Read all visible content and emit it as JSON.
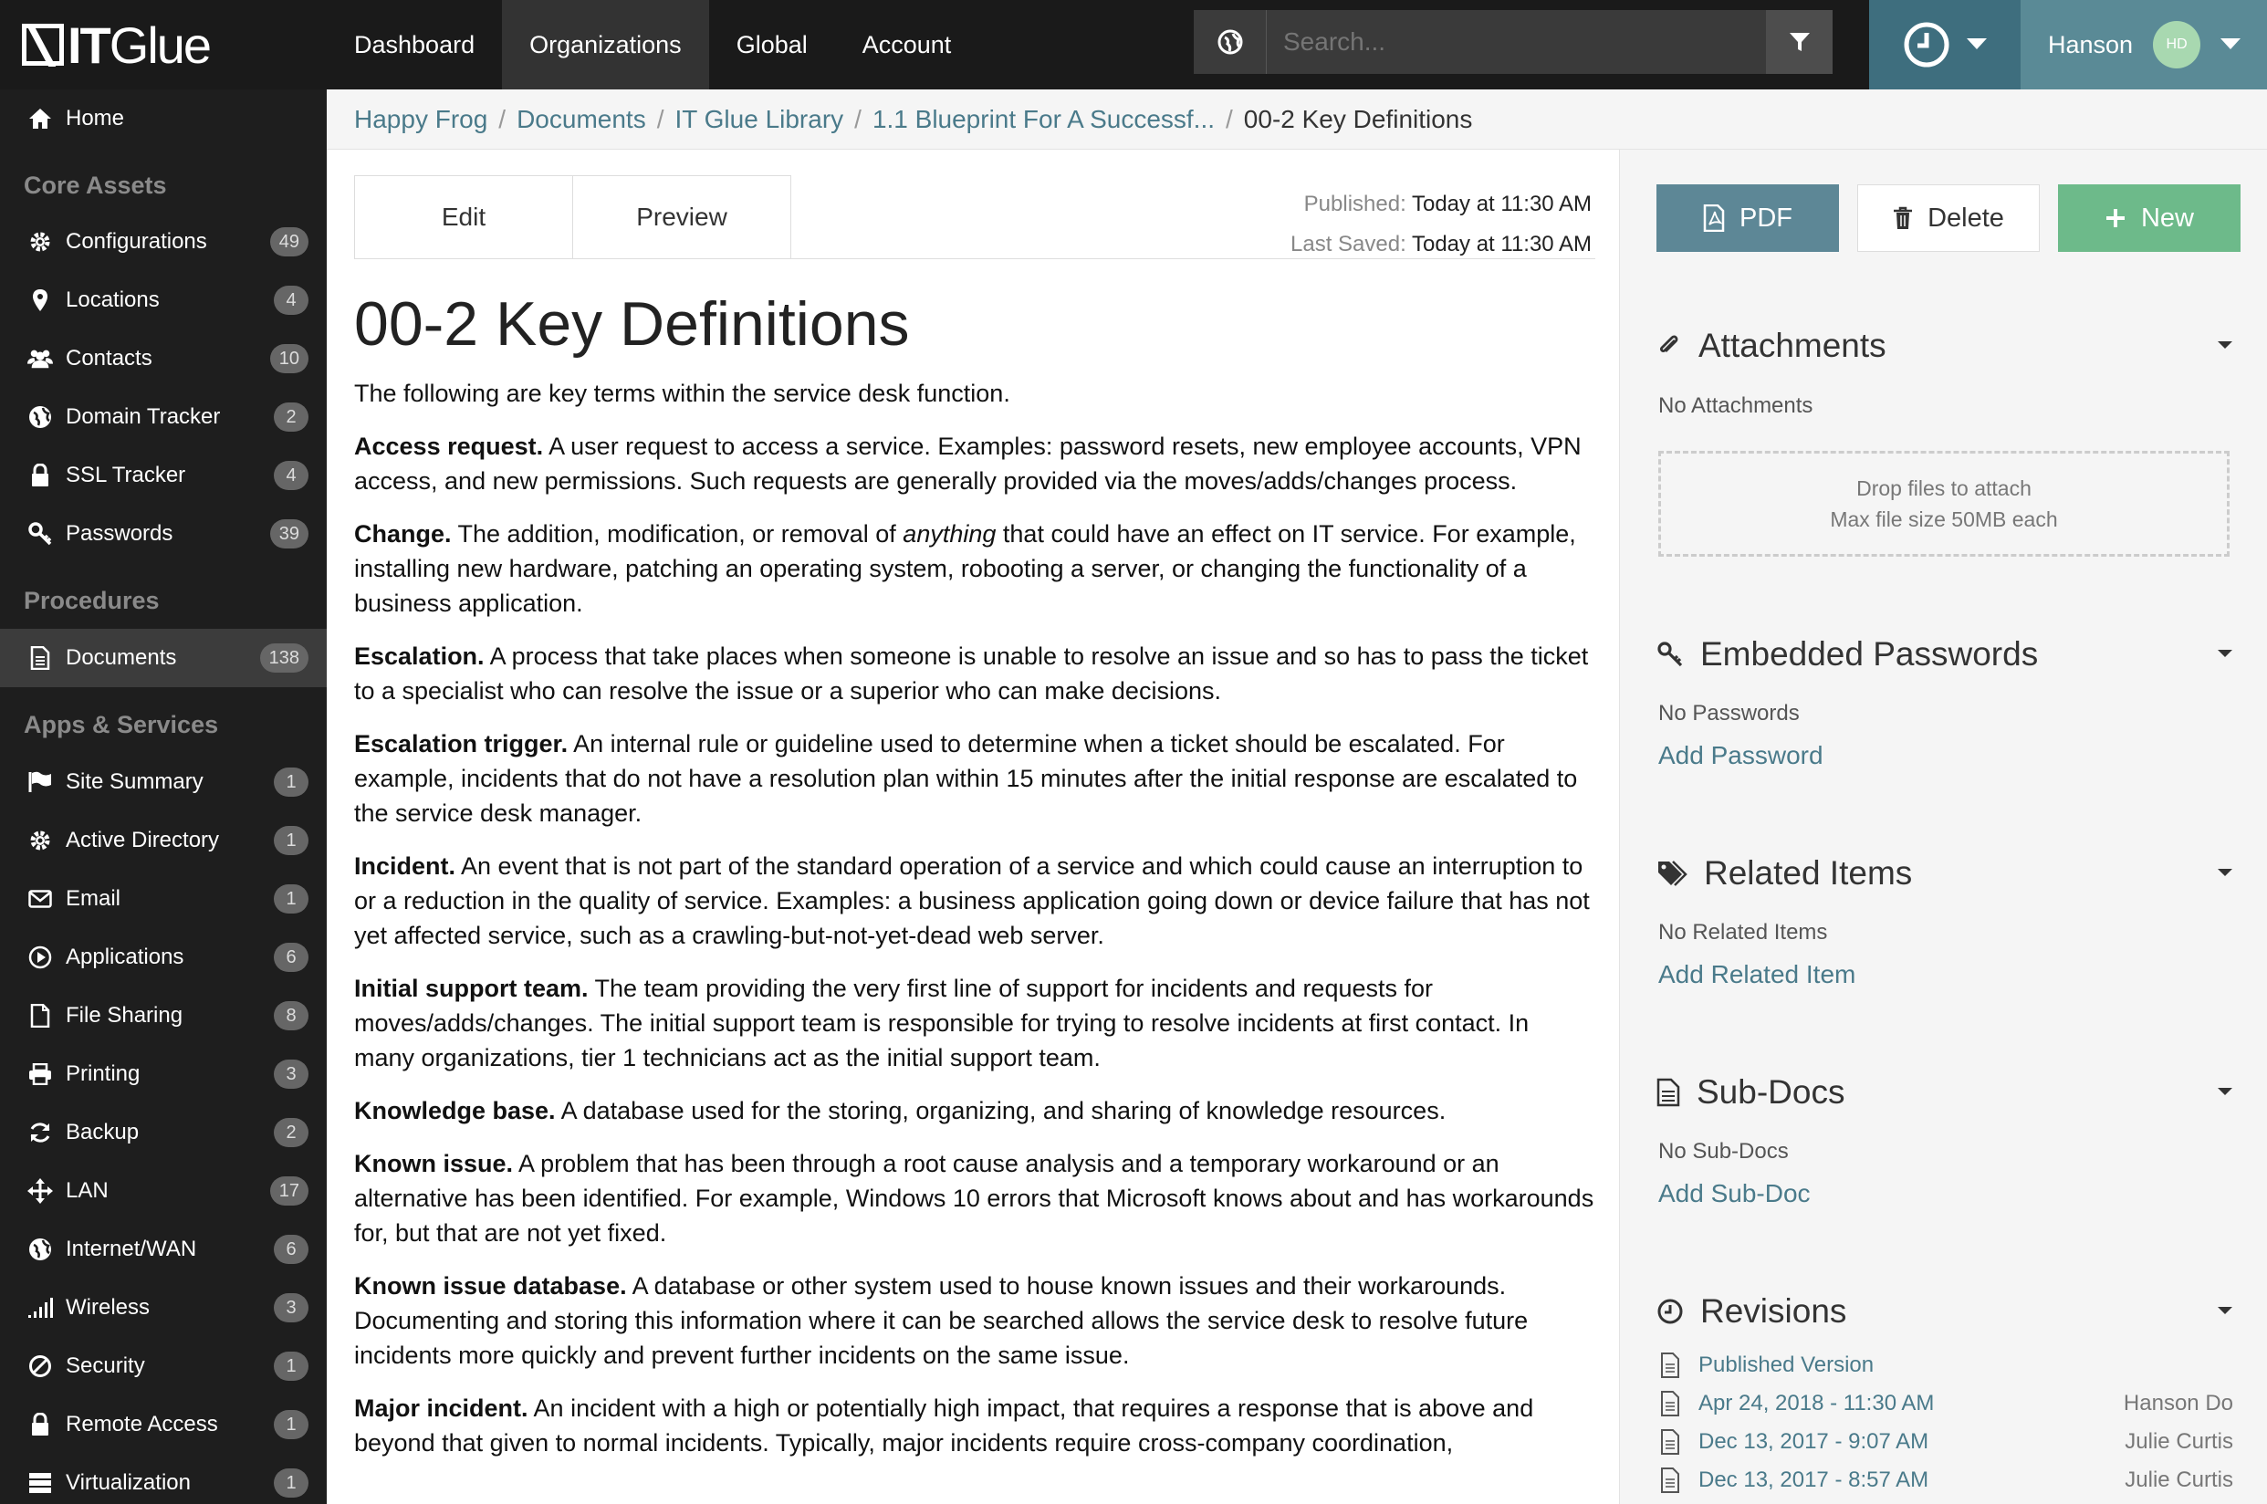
{
  "app": {
    "logo_it": "IT",
    "logo_glue": "Glue"
  },
  "topnav": {
    "tabs": [
      "Dashboard",
      "Organizations",
      "Global",
      "Account"
    ],
    "active": "Organizations"
  },
  "search": {
    "placeholder": "Search..."
  },
  "user": {
    "name": "Hanson",
    "initials": "HD"
  },
  "sidebar": {
    "home": "Home",
    "core_assets": "Core Assets",
    "core_items": [
      {
        "label": "Configurations",
        "count": "49",
        "icon": "gear-icon"
      },
      {
        "label": "Locations",
        "count": "4",
        "icon": "map-pin-icon"
      },
      {
        "label": "Contacts",
        "count": "10",
        "icon": "users-icon"
      },
      {
        "label": "Domain Tracker",
        "count": "2",
        "icon": "globe-icon"
      },
      {
        "label": "SSL Tracker",
        "count": "4",
        "icon": "lock-icon"
      },
      {
        "label": "Passwords",
        "count": "39",
        "icon": "key-icon"
      }
    ],
    "procedures": "Procedures",
    "procedure_items": [
      {
        "label": "Documents",
        "count": "138",
        "icon": "document-icon"
      }
    ],
    "apps_services": "Apps & Services",
    "app_items": [
      {
        "label": "Site Summary",
        "count": "1",
        "icon": "flag-icon"
      },
      {
        "label": "Active Directory",
        "count": "1",
        "icon": "gear-icon"
      },
      {
        "label": "Email",
        "count": "1",
        "icon": "envelope-icon"
      },
      {
        "label": "Applications",
        "count": "6",
        "icon": "play-circle-icon"
      },
      {
        "label": "File Sharing",
        "count": "8",
        "icon": "file-icon"
      },
      {
        "label": "Printing",
        "count": "3",
        "icon": "printer-icon"
      },
      {
        "label": "Backup",
        "count": "2",
        "icon": "refresh-icon"
      },
      {
        "label": "LAN",
        "count": "17",
        "icon": "arrows-icon"
      },
      {
        "label": "Internet/WAN",
        "count": "6",
        "icon": "globe-icon"
      },
      {
        "label": "Wireless",
        "count": "3",
        "icon": "signal-icon"
      },
      {
        "label": "Security",
        "count": "1",
        "icon": "ban-icon"
      },
      {
        "label": "Remote Access",
        "count": "1",
        "icon": "lock-icon"
      },
      {
        "label": "Virtualization",
        "count": "1",
        "icon": "server-icon"
      }
    ]
  },
  "breadcrumb": {
    "items": [
      "Happy Frog",
      "Documents",
      "IT Glue Library",
      "1.1 Blueprint For A Successf..."
    ],
    "current": "00-2 Key Definitions"
  },
  "editor": {
    "edit_tab": "Edit",
    "preview_tab": "Preview",
    "published_label": "Published:",
    "published_value": "Today at 11:30 AM",
    "saved_label": "Last Saved:",
    "saved_value": "Today at 11:30 AM"
  },
  "document": {
    "title": "00-2 Key Definitions",
    "intro": "The following are key terms within the service desk function.",
    "terms": [
      {
        "term": "Access request.",
        "def": "A user request to access a service. Examples: password resets, new employee accounts, VPN access, and new permissions. Such requests are generally provided via the moves/adds/changes process."
      },
      {
        "term": "Change.",
        "def_before": "The addition, modification, or removal of",
        "def_em": "anything",
        "def_after": "that could have an effect on IT service. For example, installing new hardware, patching an operating system, robooting a server, or changing the functionality of a business application."
      },
      {
        "term": "Escalation.",
        "def": "A process that take places when someone is unable to resolve an issue and so has to pass the ticket to a specialist who can resolve the issue or a superior who can make decisions."
      },
      {
        "term": "Escalation trigger.",
        "def": "An internal rule or guideline used to determine when a ticket should be escalated. For example, incidents that do not have a resolution plan within 15 minutes after the initial response are escalated to the service desk manager."
      },
      {
        "term": "Incident.",
        "def": "An event that is not part of the standard operation of a service and which could cause an interruption to or a reduction in the quality of service. Examples: a business application going down or device failure that has not yet affected service, such as a crawling-but-not-yet-dead web server."
      },
      {
        "term": "Initial support team.",
        "def": "The team providing the very first line of support for incidents and requests for moves/adds/changes. The initial support team is responsible for trying to resolve incidents at first contact. In many organizations, tier 1 technicians act as the initial support team."
      },
      {
        "term": "Knowledge base.",
        "def": "A database used for the storing, organizing, and sharing of knowledge resources."
      },
      {
        "term": "Known issue.",
        "def": "A problem that has been through a root cause analysis and a temporary workaround or an alternative has been identified. For example, Windows 10 errors that Microsoft knows about and has workarounds for, but that are not yet fixed."
      },
      {
        "term": "Known issue database.",
        "def": "A database or other system used to house known issues and their workarounds. Documenting and storing this information where it can be searched allows the service desk to resolve future incidents more quickly and prevent further incidents on the same issue."
      },
      {
        "term": "Major incident.",
        "def": "An incident with a high or potentially high impact, that requires a response that is above and beyond that given to normal incidents. Typically, major incidents require cross-company coordination,"
      }
    ]
  },
  "actions": {
    "pdf": "PDF",
    "delete": "Delete",
    "new": "New"
  },
  "attachments": {
    "title": "Attachments",
    "empty": "No Attachments",
    "drop_line1": "Drop files to attach",
    "drop_line2": "Max file size 50MB each"
  },
  "passwords": {
    "title": "Embedded Passwords",
    "empty": "No Passwords",
    "add": "Add Password"
  },
  "related": {
    "title": "Related Items",
    "empty": "No Related Items",
    "add": "Add Related Item"
  },
  "subdocs": {
    "title": "Sub-Docs",
    "empty": "No Sub-Docs",
    "add": "Add Sub-Doc"
  },
  "revisions": {
    "title": "Revisions",
    "items": [
      {
        "label": "Published Version",
        "by": ""
      },
      {
        "label": "Apr 24, 2018 - 11:30 AM",
        "by": "Hanson Do"
      },
      {
        "label": "Dec 13, 2017 - 9:07 AM",
        "by": "Julie Curtis"
      },
      {
        "label": "Dec 13, 2017 - 8:57 AM",
        "by": "Julie Curtis"
      }
    ]
  }
}
